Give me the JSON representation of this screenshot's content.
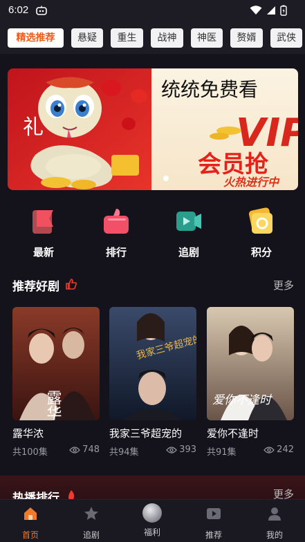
{
  "status": {
    "time": "6:02"
  },
  "categories": [
    {
      "label": "精选推荐",
      "active": true
    },
    {
      "label": "悬疑"
    },
    {
      "label": "重生"
    },
    {
      "label": "战神"
    },
    {
      "label": "神医"
    },
    {
      "label": "赘婿"
    },
    {
      "label": "武侠"
    }
  ],
  "banner": {
    "left_text": "礼",
    "headline": "统统免费看",
    "badge": "VIP",
    "sub": "会员抢",
    "tag": "火热进行中"
  },
  "quick_nav": [
    {
      "label": "最新",
      "icon": "flag-icon"
    },
    {
      "label": "排行",
      "icon": "thumbs-up-icon"
    },
    {
      "label": "追剧",
      "icon": "video-icon"
    },
    {
      "label": "积分",
      "icon": "coin-icon"
    }
  ],
  "recommended": {
    "title": "推荐好剧",
    "more": "更多",
    "items": [
      {
        "title": "露华浓",
        "episodes": "共100集",
        "views": "748",
        "poster_text": "露华浓"
      },
      {
        "title": "我家三爷超宠的",
        "episodes": "共94集",
        "views": "393",
        "poster_text": "我家三爷超宠的"
      },
      {
        "title": "爱你不逢时",
        "episodes": "共91集",
        "views": "242",
        "poster_text": "爱你不逢时"
      }
    ]
  },
  "hot": {
    "title": "热播排行",
    "more": "更多"
  },
  "tabs": [
    {
      "label": "首页",
      "icon": "home-icon",
      "active": true
    },
    {
      "label": "追剧",
      "icon": "star-icon"
    },
    {
      "label": "福利",
      "icon": "gift-orb-icon"
    },
    {
      "label": "推荐",
      "icon": "play-icon"
    },
    {
      "label": "我的",
      "icon": "user-icon"
    }
  ],
  "colors": {
    "accent": "#f05a1a",
    "background": "#14131c",
    "tab_active": "#f07a2a"
  }
}
